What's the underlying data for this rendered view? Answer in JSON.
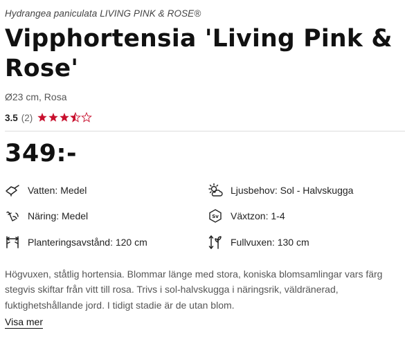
{
  "product": {
    "latin_name": "Hydrangea paniculata LIVING PINK & ROSE®",
    "title": "Vipphortensia 'Living Pink & Rose'",
    "subtitle": "Ø23 cm, Rosa",
    "rating": {
      "score": "3.5",
      "count": "(2)",
      "stars_value": 3.5,
      "stars_max": 5
    },
    "price": "349:-"
  },
  "attributes": [
    {
      "icon": "watering-can-icon",
      "label": "Vatten: Medel"
    },
    {
      "icon": "sun-cloud-icon",
      "label": "Ljusbehov: Sol - Halvskugga"
    },
    {
      "icon": "fertilizer-icon",
      "label": "Näring: Medel"
    },
    {
      "icon": "zone-icon",
      "label": "Växtzon: 1-4"
    },
    {
      "icon": "spacing-icon",
      "label": "Planteringsavstånd: 120 cm"
    },
    {
      "icon": "height-icon",
      "label": "Fullvuxen: 130 cm"
    }
  ],
  "description": "Högvuxen, ståtlig hortensia. Blommar länge med stora, koniska blomsamlingar vars färg stegvis skiftar från vitt till rosa. Trivs i sol-halvskugga i näringsrik, väldränerad, fuktighetshållande jord. I tidigt stadie är de utan blom.",
  "more_link": "Visa mer",
  "colors": {
    "star": "#c8102e",
    "text": "#1a1a1a",
    "muted": "#555555"
  }
}
